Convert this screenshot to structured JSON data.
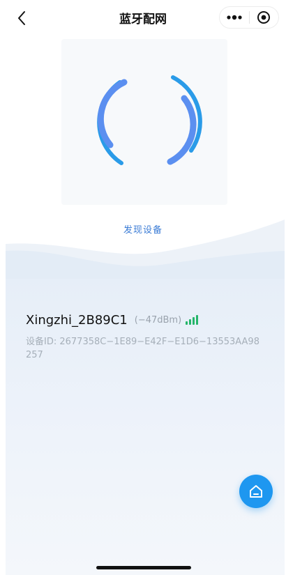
{
  "header": {
    "title": "蓝牙配网",
    "back_icon": "chevron-left-icon",
    "more_icon": "more-dots-icon",
    "close_icon": "target-circle-icon"
  },
  "scanner": {
    "status_label": "发现设备",
    "icon": "bluetooth-scan-arcs-icon"
  },
  "device": {
    "name": "Xingzhi_2B89C1",
    "rssi": "(−47dBm)",
    "signal_icon": "signal-bars-icon",
    "id_prefix": "设备ID: ",
    "id_value": "2677358C−1E89−E42F−E1D6−13553AA98257"
  },
  "fab": {
    "icon": "home-icon"
  },
  "colors": {
    "accent": "#1e97f0",
    "scan_arc": "#5b8ff0",
    "scan_arc_outer": "#2a9be8",
    "signal": "#25b56a",
    "status_text": "#3a7bd5"
  }
}
